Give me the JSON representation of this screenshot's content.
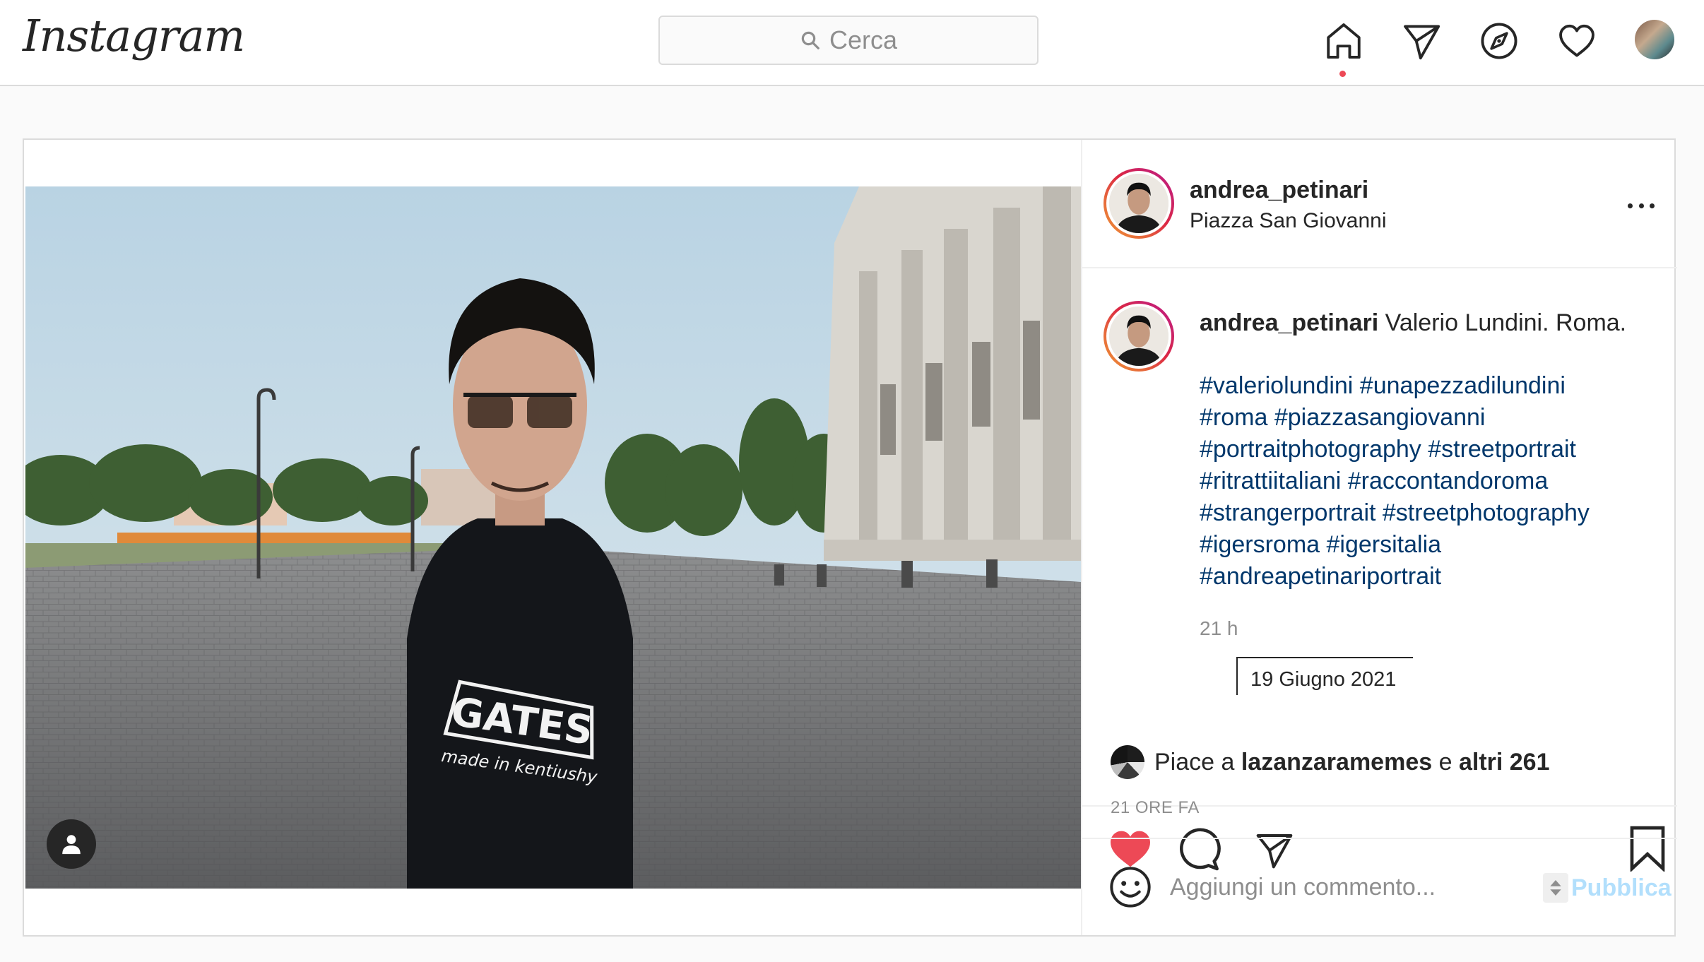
{
  "header": {
    "logo_text": "Instagram",
    "search": {
      "placeholder": "Cerca",
      "icon": "search-icon"
    },
    "nav": [
      {
        "name": "home-icon",
        "active": true
      },
      {
        "name": "direct-messages-icon"
      },
      {
        "name": "explore-icon"
      },
      {
        "name": "activity-heart-icon"
      },
      {
        "name": "profile-avatar"
      }
    ]
  },
  "post": {
    "username": "andrea_petinari",
    "location": "Piazza San Giovanni",
    "caption": {
      "username": "andrea_petinari",
      "text": "Valerio Lundini. Roma.",
      "hashtag_lines": [
        "#valeriolundini #unapezzadilundini",
        "#roma #piazzasangiovanni",
        "#portraitphotography #streetportrait",
        "#ritrattiitaliani #raccontandoroma",
        "#strangerportrait #streetphotography",
        "#igersroma #igersitalia",
        "#andreapetinariportrait"
      ],
      "time_relative": "21 h"
    },
    "tooltip_date": "19 Giugno 2021",
    "likes": {
      "prefix": "Piace a",
      "user": "lazanzaramemes",
      "connector": "e",
      "others": "altri 261"
    },
    "time_absolute": "21 ORE FA",
    "liked": true,
    "comment": {
      "placeholder": "Aggiungi un commento...",
      "submit_label": "Pubblica"
    }
  },
  "colors": {
    "like_red": "#ed4956",
    "hashtag_blue": "#00376b",
    "publish_disabled": "#b2dffc",
    "border": "#dbdbdb",
    "background": "#fafafa"
  }
}
